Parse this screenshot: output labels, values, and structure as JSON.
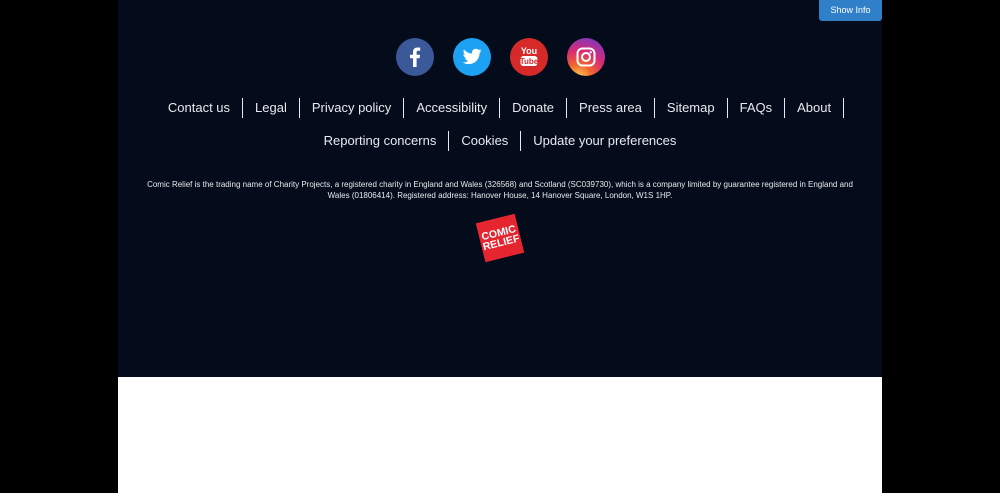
{
  "show_info_label": "Show Info",
  "social": [
    {
      "name": "facebook",
      "icon": "facebook-icon",
      "color": "#3b5998"
    },
    {
      "name": "twitter",
      "icon": "twitter-icon",
      "color": "#1da1f2"
    },
    {
      "name": "youtube",
      "icon": "youtube-icon",
      "color": "#d62a2a"
    },
    {
      "name": "instagram",
      "icon": "instagram-icon",
      "color": "#c32aa3"
    }
  ],
  "nav_primary": [
    "Contact us",
    "Legal",
    "Privacy policy",
    "Accessibility",
    "Donate",
    "Press area",
    "Sitemap",
    "FAQs",
    "About"
  ],
  "nav_secondary": [
    "Reporting concerns",
    "Cookies",
    "Update your preferences"
  ],
  "legal_text": "Comic Relief is the trading name of Charity Projects, a registered charity in England and Wales (326568) and Scotland (SC039730), which is a company limited by guarantee registered in England and Wales (01806414). Registered address: Hanover House, 14 Hanover Square, London, W1S 1HP.",
  "logo": {
    "line1": "COMIC",
    "line2": "RELIEF",
    "color": "#e52630"
  },
  "colors": {
    "footer_bg": "#040b1a",
    "accent": "#2f7fc9",
    "text": "#e8eaee"
  }
}
